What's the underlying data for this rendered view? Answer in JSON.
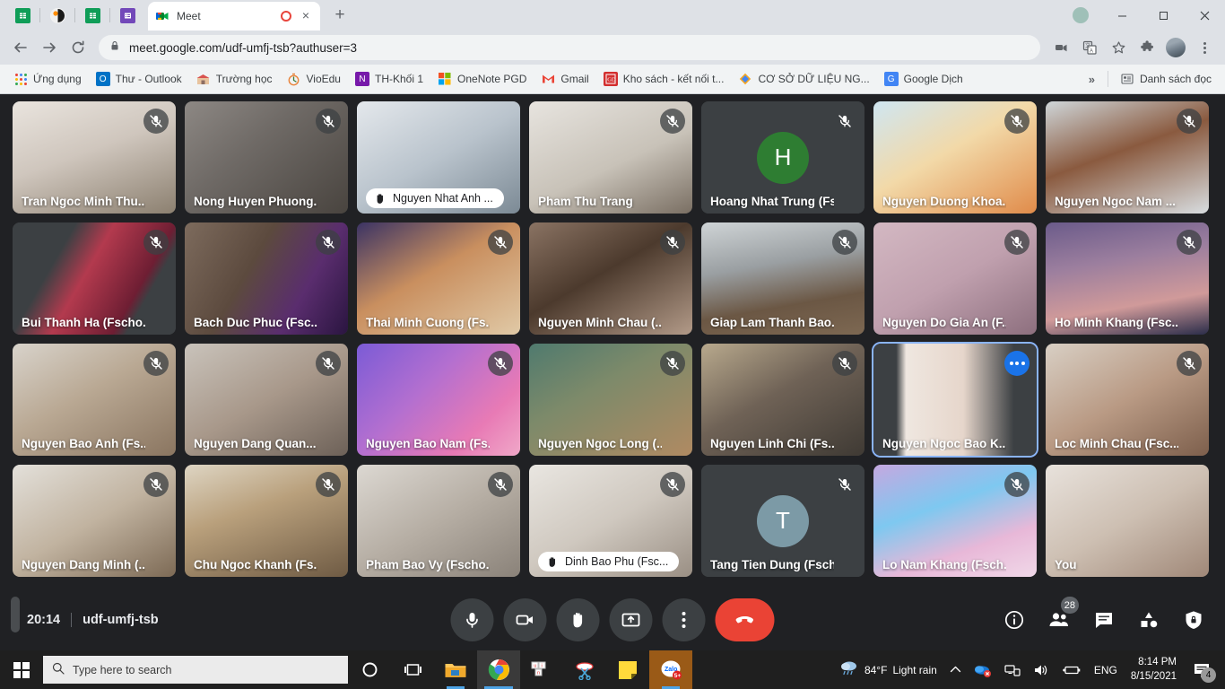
{
  "browser": {
    "pinned_icons": [
      "sheets-icon",
      "vlc-icon",
      "sheets-icon-2",
      "forms-icon"
    ],
    "tab": {
      "title": "Meet",
      "favicon": "meet-icon",
      "recording": "recording-indicator",
      "close": "×"
    },
    "new_tab_label": "+",
    "window_controls": {
      "update": "update-dot",
      "minimize": "–",
      "maximize": "□",
      "close": "✕"
    },
    "nav": {
      "back": "←",
      "forward": "→",
      "reload": "⟳"
    },
    "omnibox": {
      "lock": "lock-icon",
      "url": "meet.google.com/udf-umfj-tsb?authuser=3"
    },
    "toolbar_right": [
      "media-cast-icon",
      "translate-icon",
      "bookmark-star-icon",
      "extensions-puzzle-icon",
      "profile-avatar",
      "chrome-menu-icon"
    ],
    "bookmarks": [
      {
        "label": "Ứng dụng",
        "icon": "apps-grid-icon",
        "color": "#4285f4"
      },
      {
        "label": "Thư - Outlook",
        "icon": "outlook-icon",
        "color": "#0072c6"
      },
      {
        "label": "Trường học",
        "icon": "school-icon",
        "color": "#d9534f"
      },
      {
        "label": "VioEdu",
        "icon": "vioedu-icon",
        "color": "#f5a623"
      },
      {
        "label": "TH-Khối 1",
        "icon": "onenote-icon",
        "color": "#7719aa"
      },
      {
        "label": "OneNote PGD",
        "icon": "microsoft-icon",
        "color": "#f25022"
      },
      {
        "label": "Gmail",
        "icon": "gmail-icon",
        "color": "#ea4335"
      },
      {
        "label": "Kho sách - kết nối t...",
        "icon": "book-icon",
        "color": "#d32f2f"
      },
      {
        "label": "CƠ SỞ DỮ LIỆU NG...",
        "icon": "diamond-icon",
        "color": "#f5a623"
      },
      {
        "label": "Google Dịch",
        "icon": "translate-icon",
        "color": "#4285f4"
      }
    ],
    "bookmarks_overflow": "»",
    "reading_list": {
      "label": "Danh sách đọc",
      "icon": "reading-list-icon"
    }
  },
  "meet": {
    "participants": [
      {
        "name": "Tran Ngoc Minh Thu...",
        "muted": true,
        "hand": false,
        "bg": "linear-gradient(160deg,#e9e4de 0%,#cfc6bd 45%,#8c8070 100%)",
        "type": "video"
      },
      {
        "name": "Nong Huyen Phuong...",
        "muted": true,
        "hand": false,
        "bg": "linear-gradient(140deg,#8d8884 0%,#6f6a66 40%,#49443f 100%)",
        "type": "video"
      },
      {
        "name": "Nguyen Nhat Anh ...",
        "muted": false,
        "hand": true,
        "bg": "linear-gradient(150deg,#e4e8ec 0%,#b9c3cc 50%,#7c8a95 100%)",
        "type": "video"
      },
      {
        "name": "Pham Thu Trang",
        "muted": true,
        "hand": false,
        "bg": "linear-gradient(155deg,#e7e4df 0%,#c8c2b8 55%,#7a6f63 100%)",
        "type": "video"
      },
      {
        "name": "Hoang Nhat Trung (Fs...",
        "muted": true,
        "hand": false,
        "bg": "#3c4043",
        "type": "avatar",
        "initial": "H",
        "avatar_color": "#2e7d32"
      },
      {
        "name": "Nguyen Duong Khoa...",
        "muted": true,
        "hand": false,
        "bg": "linear-gradient(150deg,#cfe6f2 0%,#f2d9a8 45%,#e08b4a 100%)",
        "type": "video"
      },
      {
        "name": "Nguyen Ngoc Nam ...",
        "muted": true,
        "hand": false,
        "bg": "linear-gradient(160deg,#cfd6d9 0%,#8a5a3f 45%,#d8dde0 100%)",
        "type": "video"
      },
      {
        "name": "Bui Thanh Ha (Fscho...",
        "muted": true,
        "hand": false,
        "bg": "linear-gradient(120deg,#3c4043 0%,#3c4043 28%,#b33a4e 45%,#6e1e33 72%,#3c4043 78%,#3c4043 100%)",
        "type": "video"
      },
      {
        "name": "Bach Duc Phuc (Fsc...",
        "muted": true,
        "hand": false,
        "bg": "linear-gradient(120deg,#7d6b5d 0%,#5c4a3e 40%,#5a2d6e 70%,#2a1540 100%)",
        "type": "video"
      },
      {
        "name": "Thai Minh Cuong (Fs...",
        "muted": true,
        "hand": false,
        "bg": "linear-gradient(150deg,#3b3364 0%,#c98f5f 45%,#e0c9a6 100%)",
        "type": "video"
      },
      {
        "name": "Nguyen Minh Chau (...",
        "muted": true,
        "hand": false,
        "bg": "linear-gradient(150deg,#8a7363 0%,#4c3a2d 45%,#b29a88 100%)",
        "type": "video"
      },
      {
        "name": "Giap Lam Thanh Bao...",
        "muted": true,
        "hand": false,
        "bg": "linear-gradient(170deg,#cfd4d6 0%,#9a9fa2 38%,#6b5744 70%,#7d6852 100%)",
        "type": "video"
      },
      {
        "name": "Nguyen Do Gia An (F...",
        "muted": true,
        "hand": false,
        "bg": "linear-gradient(150deg,#d3b8c2 0%,#c0a0ae 50%,#8d6f7e 100%)",
        "type": "video"
      },
      {
        "name": "Ho Minh Khang (Fsc...",
        "muted": true,
        "hand": false,
        "bg": "linear-gradient(170deg,#6b5b8a 0%,#9b7e9e 35%,#d09a9a 70%,#2b2d4a 100%)",
        "type": "video"
      },
      {
        "name": "Nguyen Bao Anh (Fs...",
        "muted": true,
        "hand": false,
        "bg": "linear-gradient(150deg,#d8d3cb 0%,#b9a893 45%,#8a7560 100%)",
        "type": "video"
      },
      {
        "name": "Nguyen Dang Quan...",
        "muted": true,
        "hand": false,
        "bg": "linear-gradient(150deg,#c9c3bb 0%,#a8988a 50%,#6d6158 100%)",
        "type": "video"
      },
      {
        "name": "Nguyen Bao Nam (Fs...",
        "muted": true,
        "hand": false,
        "bg": "linear-gradient(135deg,#7b5bd6 0%,#b36fd0 40%,#e87ab5 75%,#f0a8c8 100%)",
        "type": "video"
      },
      {
        "name": "Nguyen Ngoc Long (...",
        "muted": true,
        "hand": false,
        "bg": "linear-gradient(150deg,#4f7a6e 0%,#7d8a6a 40%,#b08a62 100%)",
        "type": "video"
      },
      {
        "name": "Nguyen Linh Chi (Fs...",
        "muted": true,
        "hand": false,
        "bg": "linear-gradient(150deg,#b8a98d 0%,#6f6256 45%,#3f3a34 100%)",
        "type": "video"
      },
      {
        "name": "Nguyen Ngoc Bao K...",
        "muted": false,
        "hand": false,
        "selected": true,
        "bg": "linear-gradient(90deg,#3c4043 0%,#3c4043 14%,#efe7e0 20%,#e6d6cb 55%,#3c4043 86%,#3c4043 100%)",
        "type": "video"
      },
      {
        "name": "Loc Minh Chau (Fsc...",
        "muted": true,
        "hand": false,
        "bg": "linear-gradient(150deg,#d8cfc4 0%,#b99a84 50%,#7d5f4c 100%)",
        "type": "video"
      },
      {
        "name": "Nguyen Dang Minh (...",
        "muted": true,
        "hand": false,
        "bg": "linear-gradient(150deg,#e3e0da 0%,#c1b3a0 50%,#7d6a55 100%)",
        "type": "video"
      },
      {
        "name": "Chu Ngoc Khanh (Fs...",
        "muted": true,
        "hand": false,
        "bg": "linear-gradient(160deg,#ded5c3 0%,#b9a07c 40%,#6f5b44 100%)",
        "type": "video"
      },
      {
        "name": "Pham Bao Vy (Fscho...",
        "muted": true,
        "hand": false,
        "bg": "linear-gradient(150deg,#dcd8d2 0%,#b6aea4 50%,#8a8279 100%)",
        "type": "video"
      },
      {
        "name": "Dinh Bao Phu (Fsc...",
        "muted": true,
        "hand": true,
        "bg": "linear-gradient(150deg,#e9e6e1 0%,#cfc8bf 50%,#9a8f84 100%)",
        "type": "video"
      },
      {
        "name": "Tang Tien Dung (Fsch...",
        "muted": true,
        "hand": false,
        "bg": "#3c4043",
        "type": "avatar",
        "initial": "T",
        "avatar_color": "#7c9aa6"
      },
      {
        "name": "Lo Nam Khang (Fsch...",
        "muted": true,
        "hand": false,
        "bg": "linear-gradient(160deg,#c5a8e0 0%,#7ec8f0 38%,#e8b8d8 70%,#f0d8e8 100%)",
        "type": "video"
      },
      {
        "name": "You",
        "muted": false,
        "hand": false,
        "bg": "linear-gradient(150deg,#e8e2dc 0%,#cdbfb2 50%,#a08878 100%)",
        "type": "video"
      }
    ],
    "bottom": {
      "elapsed": "20:14",
      "meeting_code": "udf-umfj-tsb",
      "controls": [
        {
          "name": "microphone-button",
          "icon": "mic-icon"
        },
        {
          "name": "camera-button",
          "icon": "camera-icon"
        },
        {
          "name": "raise-hand-button",
          "icon": "hand-icon"
        },
        {
          "name": "present-screen-button",
          "icon": "present-icon"
        },
        {
          "name": "more-options-button",
          "icon": "kebab-icon"
        },
        {
          "name": "leave-call-button",
          "icon": "hangup-icon"
        }
      ],
      "right_controls": [
        {
          "name": "meeting-details-button",
          "icon": "info-icon",
          "badge": ""
        },
        {
          "name": "show-everyone-button",
          "icon": "people-icon",
          "badge": "28"
        },
        {
          "name": "chat-button",
          "icon": "chat-icon",
          "badge": ""
        },
        {
          "name": "activities-button",
          "icon": "activities-icon",
          "badge": ""
        },
        {
          "name": "host-controls-button",
          "icon": "shield-lock-icon",
          "badge": ""
        }
      ]
    }
  },
  "taskbar": {
    "start": "windows-logo",
    "search_placeholder": "Type here to search",
    "search_icon": "search-icon",
    "cortana": "cortana-icon",
    "task_view": "task-view-icon",
    "apps": [
      {
        "name": "file-explorer",
        "icon": "folder-icon"
      },
      {
        "name": "google-chrome",
        "icon": "chrome-icon"
      },
      {
        "name": "unikey",
        "icon": "unikey-icon"
      },
      {
        "name": "snipping-tool",
        "icon": "scissors-icon"
      },
      {
        "name": "sticky-notes",
        "icon": "note-icon"
      },
      {
        "name": "zalo",
        "icon": "zalo-icon",
        "badge": "5+"
      }
    ],
    "tray": {
      "weather_temp": "84°F",
      "weather_desc": "Light rain",
      "weather_icon": "rain-cloud-icon",
      "overflow": "^",
      "icons": [
        "onedrive-error-icon",
        "network-icon",
        "volume-icon",
        "battery-icon"
      ],
      "language": "ENG",
      "time": "8:14 PM",
      "date": "8/15/2021",
      "notifications": "4"
    }
  }
}
